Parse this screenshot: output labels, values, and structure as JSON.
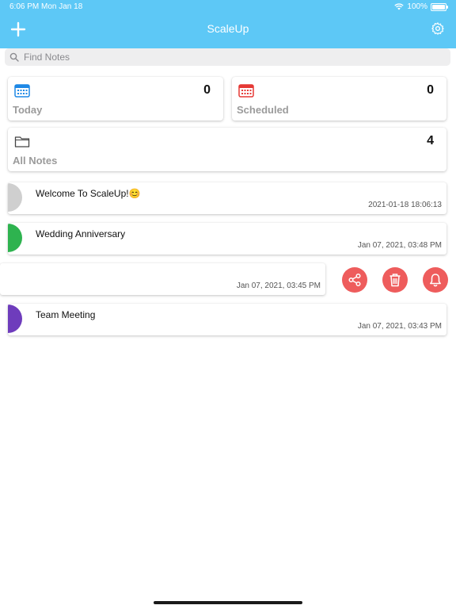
{
  "status_bar": {
    "time": "6:06 PM",
    "date": "Mon Jan 18",
    "battery": "100%"
  },
  "header": {
    "title": "ScaleUp",
    "background": "#5dc8f6"
  },
  "search": {
    "placeholder": "Find Notes"
  },
  "summary_cards": [
    {
      "label": "Today",
      "count": "0",
      "icon": "calendar-icon",
      "icon_color": "#1e88e5"
    },
    {
      "label": "Scheduled",
      "count": "0",
      "icon": "calendar-icon",
      "icon_color": "#e53935"
    },
    {
      "label": "All Notes",
      "count": "4",
      "icon": "folder-icon",
      "icon_color": "#444444"
    }
  ],
  "notes": [
    {
      "title": "Welcome To ScaleUp!😊",
      "date": "2021-01-18 18:06:13",
      "color": "#cfcfcf"
    },
    {
      "title": "Wedding Anniversary",
      "date": "Jan 07, 2021, 03:48 PM",
      "color": "#2eb34f"
    },
    {
      "title": "",
      "date": "Jan 07, 2021, 03:45 PM",
      "color": "#ffffff"
    },
    {
      "title": "Team Meeting",
      "date": "Jan 07, 2021, 03:43 PM",
      "color": "#6e3cbc"
    }
  ],
  "swipe_actions": [
    {
      "icon": "share-icon"
    },
    {
      "icon": "trash-icon"
    },
    {
      "icon": "bell-icon"
    }
  ],
  "accent_colors": {
    "action": "#ee5c5c"
  }
}
